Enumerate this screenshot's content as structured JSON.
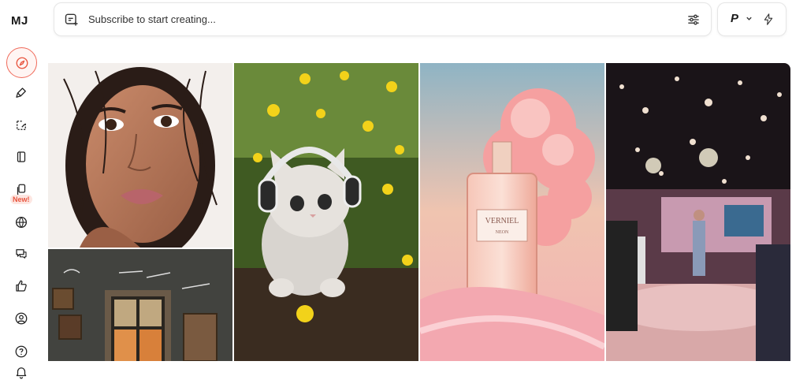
{
  "sidebar": {
    "logo": "MJ",
    "items": [
      {
        "name": "explore",
        "icon": "compass-icon",
        "active": true
      },
      {
        "name": "create",
        "icon": "brush-icon"
      },
      {
        "name": "edit",
        "icon": "edit-square-icon"
      },
      {
        "name": "personalize",
        "icon": "book-icon"
      },
      {
        "name": "moodboards",
        "icon": "cards-icon",
        "badge": "New!"
      },
      {
        "name": "rooms",
        "icon": "globe-icon"
      },
      {
        "name": "chat",
        "icon": "chat-icon"
      },
      {
        "name": "likes",
        "icon": "thumbs-up-icon"
      },
      {
        "name": "profile",
        "icon": "user-circle-icon"
      },
      {
        "name": "help",
        "icon": "help-icon"
      },
      {
        "name": "notifications",
        "icon": "bell-icon"
      }
    ]
  },
  "prompt": {
    "placeholder": "Subscribe to start creating..."
  },
  "account": {
    "initial": "P"
  },
  "gallery": {
    "tiles": [
      {
        "subject": "portrait-woman"
      },
      {
        "subject": "room-interior"
      },
      {
        "subject": "kitten-headphones"
      },
      {
        "subject": "perfume-bottle",
        "label_line1": "VERNIEL",
        "label_line2": "NEON"
      },
      {
        "subject": "stage-confetti"
      }
    ]
  },
  "colors": {
    "accent": "#f06a5a",
    "border": "#e6e6e6"
  }
}
